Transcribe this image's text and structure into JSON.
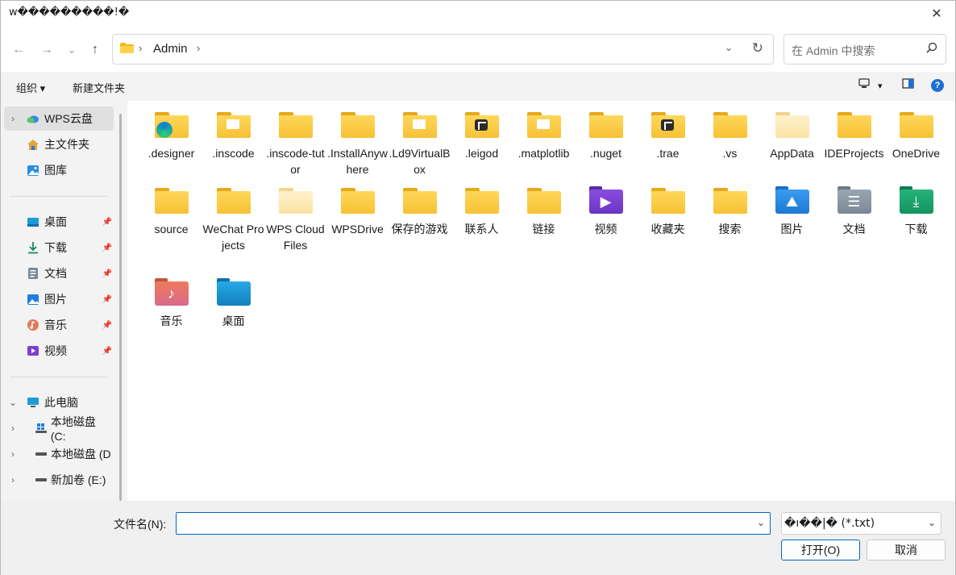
{
  "window": {
    "title": "w���������!�",
    "close": "✕"
  },
  "nav": {
    "back": "←",
    "forward": "→",
    "recent": "⌄",
    "up": "↑"
  },
  "address": {
    "chev1": "›",
    "path": "Admin",
    "chev2": "›",
    "dropdown": "⌄",
    "refresh": "↻"
  },
  "search": {
    "placeholder": "在 Admin 中搜索",
    "icon": "⚲"
  },
  "toolbar": {
    "organize": "组织 ▾",
    "new_folder": "新建文件夹",
    "view_icon": "▣",
    "view_dd": "▾",
    "pane_icon": "▥",
    "help": "?"
  },
  "sidebar": {
    "cloud": {
      "chev": "›",
      "label": "WPS云盘"
    },
    "quick": [
      {
        "label": "主文件夹",
        "icon": "home-icon"
      },
      {
        "label": "图库",
        "icon": "gallery-icon"
      }
    ],
    "pinned": [
      {
        "label": "桌面",
        "icon": "desktop-icon",
        "pin": "📌"
      },
      {
        "label": "下载",
        "icon": "download-icon",
        "pin": "📌"
      },
      {
        "label": "文档",
        "icon": "document-icon",
        "pin": "📌"
      },
      {
        "label": "图片",
        "icon": "picture-icon",
        "pin": "📌"
      },
      {
        "label": "音乐",
        "icon": "music-icon",
        "pin": "📌"
      },
      {
        "label": "视频",
        "icon": "video-icon",
        "pin": "📌"
      }
    ],
    "pc": {
      "chev": "⌄",
      "label": "此电脑"
    },
    "drives": [
      {
        "chev": "›",
        "label": "本地磁盘 (C:"
      },
      {
        "chev": "›",
        "label": "本地磁盘 (D"
      },
      {
        "chev": "›",
        "label": "新加卷 (E:)"
      }
    ]
  },
  "items": [
    {
      "label": ".designer",
      "kind": "folder-edge"
    },
    {
      "label": ".inscode",
      "kind": "folder-paper"
    },
    {
      "label": ".inscode-tutor",
      "kind": "folder"
    },
    {
      "label": ".InstallAnywhere",
      "kind": "folder"
    },
    {
      "label": ".Ld9VirtualBox",
      "kind": "folder-paper"
    },
    {
      "label": ".leigod",
      "kind": "folder-badge"
    },
    {
      "label": ".matplotlib",
      "kind": "folder-paper"
    },
    {
      "label": ".nuget",
      "kind": "folder"
    },
    {
      "label": ".trae",
      "kind": "folder-badge"
    },
    {
      "label": ".vs",
      "kind": "folder"
    },
    {
      "label": "AppData",
      "kind": "folder-light"
    },
    {
      "label": "IDEProjects",
      "kind": "folder"
    },
    {
      "label": "OneDrive",
      "kind": "folder"
    },
    {
      "label": "source",
      "kind": "folder"
    },
    {
      "label": "WeChat Projects",
      "kind": "folder"
    },
    {
      "label": "WPS Cloud Files",
      "kind": "folder-light"
    },
    {
      "label": "WPSDrive",
      "kind": "folder"
    },
    {
      "label": "保存的游戏",
      "kind": "folder"
    },
    {
      "label": "联系人",
      "kind": "folder"
    },
    {
      "label": "链接",
      "kind": "folder"
    },
    {
      "label": "视频",
      "kind": "video"
    },
    {
      "label": "收藏夹",
      "kind": "folder"
    },
    {
      "label": "搜索",
      "kind": "folder"
    },
    {
      "label": "图片",
      "kind": "pictures"
    },
    {
      "label": "文档",
      "kind": "documents"
    },
    {
      "label": "下载",
      "kind": "downloads"
    },
    {
      "label": "音乐",
      "kind": "music"
    },
    {
      "label": "桌面",
      "kind": "desktop"
    }
  ],
  "footer": {
    "filename_label": "文件名(N):",
    "filename_value": "",
    "filename_dd": "⌄",
    "filetype": "�ı��|� (*.txt)",
    "filetype_dd": "⌄",
    "open": "打开(O)",
    "cancel": "取消"
  },
  "colors": {
    "accent": "#0067c0",
    "folder": "#f7c136",
    "selected": "#e0e0e0"
  }
}
